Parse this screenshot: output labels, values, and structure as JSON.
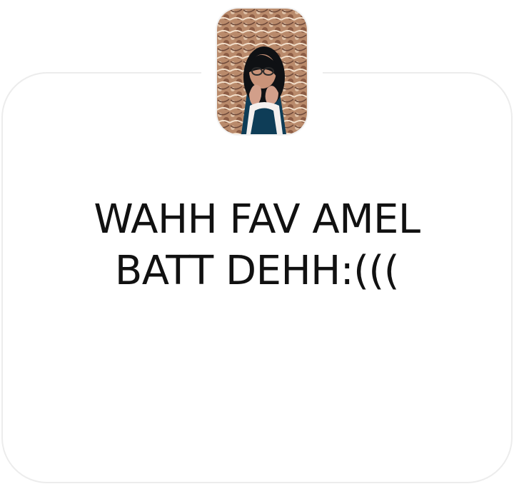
{
  "prompt_card": {
    "avatar_icon": "user-photo-avatar",
    "message_lines": [
      "WAHH FAV AMEL",
      "BATT DEHH:((("
    ]
  }
}
